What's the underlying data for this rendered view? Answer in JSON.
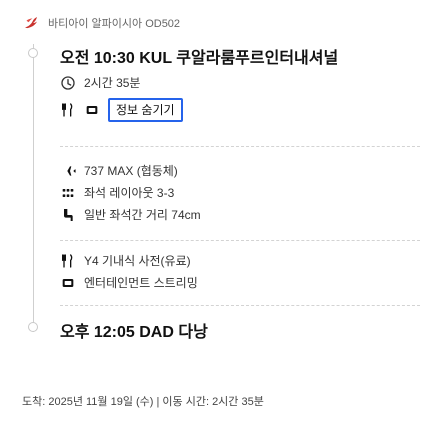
{
  "header": {
    "meta": "바티아이 알파이시아 OD502"
  },
  "departure": {
    "time_airport": "오전 10:30 KUL 쿠알라룸푸르인터내셔널",
    "duration": "2시간 35분",
    "pill_label": "정보 숨기기"
  },
  "aircraft": {
    "model": "737 MAX (협동체)",
    "seat_layout": "좌석 레이아웃 3-3",
    "seat_pitch": "일반 좌석간 거리 74cm"
  },
  "services": {
    "baggage": "Y4 기내식 사전(유료)",
    "entertainment": "엔터테인먼트 스트리밍"
  },
  "arrival": {
    "time_airport": "오후 12:05 DAD 다낭"
  },
  "footer": {
    "text": "도착: 2025년 11월 19일 (수) | 이동 시간: 2시간 35분"
  }
}
